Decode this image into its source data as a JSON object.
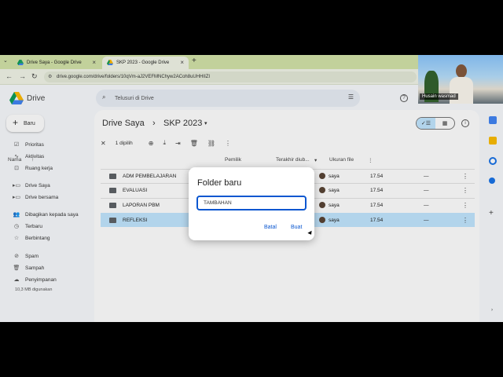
{
  "browser": {
    "tabs": [
      {
        "label": "Drive Saya - Google Drive",
        "active": false
      },
      {
        "label": "SKP 2023 - Google Drive",
        "active": true
      }
    ],
    "url": "drive.google.com/drive/folders/10qVm-aJ2VEFMNChyw2ACoh8uUHHIIZI"
  },
  "webcam": {
    "name": "Husain wasmad"
  },
  "header": {
    "brand": "Drive",
    "search_placeholder": "Telusuri di Drive"
  },
  "sidebar": {
    "new_button": "Baru",
    "items": [
      {
        "icon": "checkbox-icon",
        "label": "Prioritas"
      },
      {
        "icon": "activity-icon",
        "label": "Aktivitas"
      },
      {
        "icon": "workspace-icon",
        "label": "Ruang kerja"
      },
      {
        "icon": "my-drive-icon",
        "label": "Drive Saya"
      },
      {
        "icon": "shared-drive-icon",
        "label": "Drive bersama"
      },
      {
        "icon": "people-icon",
        "label": "Dibagikan kepada saya"
      },
      {
        "icon": "clock-icon",
        "label": "Terbaru"
      },
      {
        "icon": "star-icon",
        "label": "Berbintang"
      },
      {
        "icon": "spam-icon",
        "label": "Spam"
      },
      {
        "icon": "trash-icon",
        "label": "Sampah"
      },
      {
        "icon": "cloud-icon",
        "label": "Penyimpanan"
      }
    ],
    "storage_used": "10,3 MB digunakan"
  },
  "main": {
    "breadcrumb_root": "Drive Saya",
    "breadcrumb_sep": "›",
    "breadcrumb_current": "SKP 2023",
    "selection_count": "1 dipilih",
    "columns": {
      "name": "Nama",
      "owner": "Pemilik",
      "modified": "Terakhir diub...",
      "size": "Ukuran file"
    },
    "rows": [
      {
        "name": "ADM PEMBELAJARAN",
        "owner": "saya",
        "modified": "17.54",
        "size": "—",
        "selected": false
      },
      {
        "name": "EVALUASI",
        "owner": "saya",
        "modified": "17.54",
        "size": "—",
        "selected": false
      },
      {
        "name": "LAPORAN PBM",
        "owner": "saya",
        "modified": "17.54",
        "size": "—",
        "selected": false
      },
      {
        "name": "REFLEKSI",
        "owner": "saya",
        "modified": "17.54",
        "size": "—",
        "selected": true
      }
    ]
  },
  "dialog": {
    "title": "Folder baru",
    "input_value": "TAMBAHAN",
    "cancel": "Batal",
    "create": "Buat"
  },
  "colors": {
    "accent": "#0b57d0",
    "selected_row": "#c2e7ff",
    "tab_strip": "#d3e3a9"
  }
}
